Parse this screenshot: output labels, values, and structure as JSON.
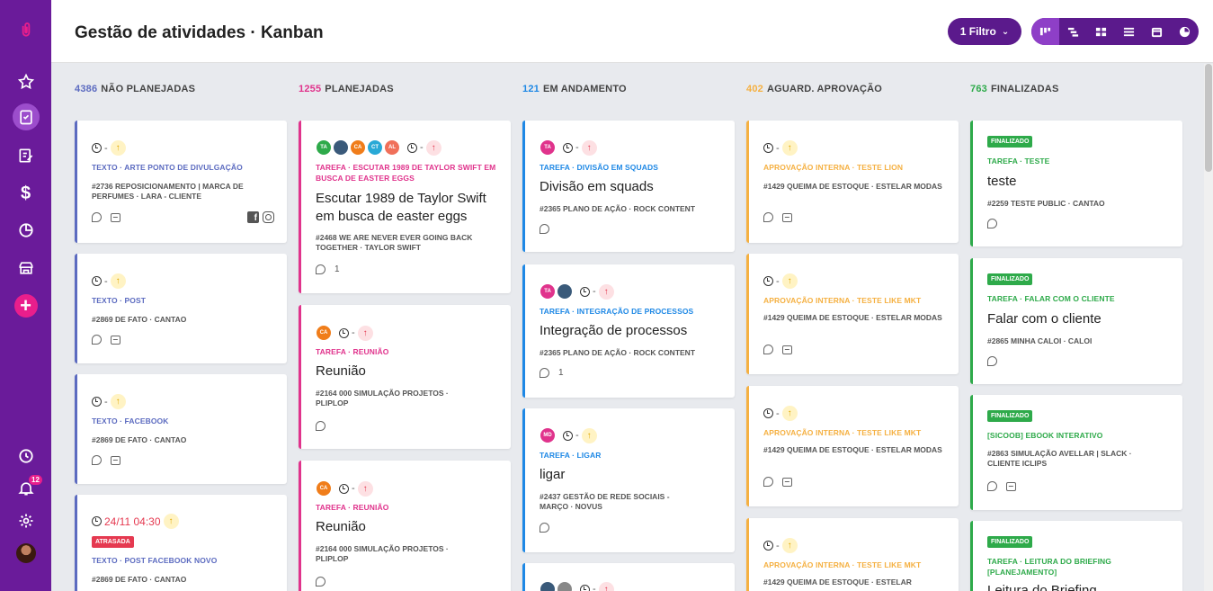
{
  "sidebar": {
    "logo_icon": "paperclip-icon",
    "notification_count": "12",
    "colors": {
      "bg": "#6a1b9a",
      "accent": "#e91e8c"
    }
  },
  "header": {
    "title": "Gestão de atividades · Kanban",
    "filter_label": "1 Filtro",
    "views": [
      "kanban-view-icon",
      "gantt-view-icon",
      "grid-view-icon",
      "list-view-icon",
      "calendar-view-icon",
      "chart-view-icon"
    ]
  },
  "columns": [
    {
      "count": "4386",
      "label": "NÃO PLANEJADAS",
      "color": "#5c6bc0",
      "cards": [
        {
          "prio": "↑",
          "cat": "TEXTO · ARTE PONTO DE DIVULGAÇÃO",
          "sub": "#2736 REPOSICIONAMENTO | MARCA DE PERFUMES · LARA - CLIENTE"
        },
        {
          "prio": "↑",
          "cat": "TEXTO · POST",
          "sub": "#2869 DE FATO · CANTAO"
        },
        {
          "prio": "↑",
          "cat": "TEXTO · FACEBOOK",
          "sub": "#2869 DE FATO · CANTAO"
        },
        {
          "date": "24/11 04:30",
          "prio": "↑",
          "tag": "ATRASADA",
          "cat": "TEXTO · POST FACEBOOK NOVO",
          "sub": "#2869 DE FATO · CANTAO"
        }
      ]
    },
    {
      "count": "1255",
      "label": "PLANEJADAS",
      "color": "#e0338c",
      "cards": [
        {
          "avatars": [
            "TA",
            "",
            "CA",
            "CT",
            "AL"
          ],
          "prio": "↑",
          "cat": "TAREFA · ESCUTAR 1989 DE TAYLOR SWIFT EM BUSCA DE EASTER EGGS",
          "title": "Escutar 1989 de Taylor Swift em busca de easter eggs",
          "sub": "#2468 WE ARE NEVER EVER GOING BACK TOGETHER · TAYLOR SWIFT",
          "comments": "1"
        },
        {
          "avatars": [
            "CA"
          ],
          "prio": "↑",
          "cat": "TAREFA · REUNIÃO",
          "title": "Reunião",
          "sub": "#2164 000 SIMULAÇÃO PROJETOS · PLIPLOP"
        },
        {
          "avatars": [
            "CA"
          ],
          "prio": "↑",
          "cat": "TAREFA · REUNIÃO",
          "title": "Reunião",
          "sub": "#2164 000 SIMULAÇÃO PROJETOS · PLIPLOP"
        }
      ]
    },
    {
      "count": "121",
      "label": "EM ANDAMENTO",
      "color": "#1e88e5",
      "cards": [
        {
          "avatars": [
            "TA"
          ],
          "prio": "↑",
          "cat": "TAREFA · DIVISÃO EM SQUADS",
          "title": "Divisão em squads",
          "sub": "#2365 PLANO DE AÇÃO · ROCK CONTENT"
        },
        {
          "avatars": [
            "TA",
            ""
          ],
          "prio": "↑",
          "cat": "TAREFA · INTEGRAÇÃO DE PROCESSOS",
          "title": "Integração de processos",
          "sub": "#2365 PLANO DE AÇÃO · ROCK CONTENT",
          "comments": "1"
        },
        {
          "avatars": [
            "MD"
          ],
          "prio": "↑",
          "cat": "TAREFA · LIGAR",
          "title": "ligar",
          "sub": "#2437 GESTÃO DE REDE SOCIAIS - MARÇO · NOVUS"
        }
      ]
    },
    {
      "count": "402",
      "label": "AGUARD. APROVAÇÃO",
      "color": "#f5b041",
      "cards": [
        {
          "prio": "↑",
          "cat": "APROVAÇÃO INTERNA · TESTE LION",
          "sub": "#1429 QUEIMA DE ESTOQUE · ESTELAR MODAS"
        },
        {
          "prio": "↑",
          "cat": "APROVAÇÃO INTERNA · TESTE LIKE MKT",
          "sub": "#1429 QUEIMA DE ESTOQUE · ESTELAR MODAS"
        },
        {
          "prio": "↑",
          "cat": "APROVAÇÃO INTERNA · TESTE LIKE MKT",
          "sub": "#1429 QUEIMA DE ESTOQUE · ESTELAR MODAS"
        },
        {
          "prio": "↑",
          "cat": "APROVAÇÃO INTERNA · TESTE LIKE MKT",
          "sub": "#1429 QUEIMA DE ESTOQUE · ESTELAR"
        }
      ]
    },
    {
      "count": "763",
      "label": "FINALIZADAS",
      "color": "#2eaa4a",
      "cards": [
        {
          "tag": "FINALIZADO",
          "cat": "TAREFA · TESTE",
          "title": "teste",
          "sub": "#2259 TESTE PUBLIC · CANTAO"
        },
        {
          "tag": "FINALIZADO",
          "cat": "TAREFA · FALAR COM O CLIENTE",
          "title": "Falar com o cliente",
          "sub": "#2865 MINHA CALOI · CALOI"
        },
        {
          "tag": "FINALIZADO",
          "cat": "[SICOOB] EBOOK INTERATIVO",
          "sub": "#2863 SIMULAÇÃO AVELLAR | SLACK · CLIENTE ICLIPS"
        },
        {
          "tag": "FINALIZADO",
          "cat": "TAREFA · LEITURA DO BRIEFING [PLANEJAMENTO]",
          "title": "Leitura do Briefing"
        }
      ]
    }
  ]
}
